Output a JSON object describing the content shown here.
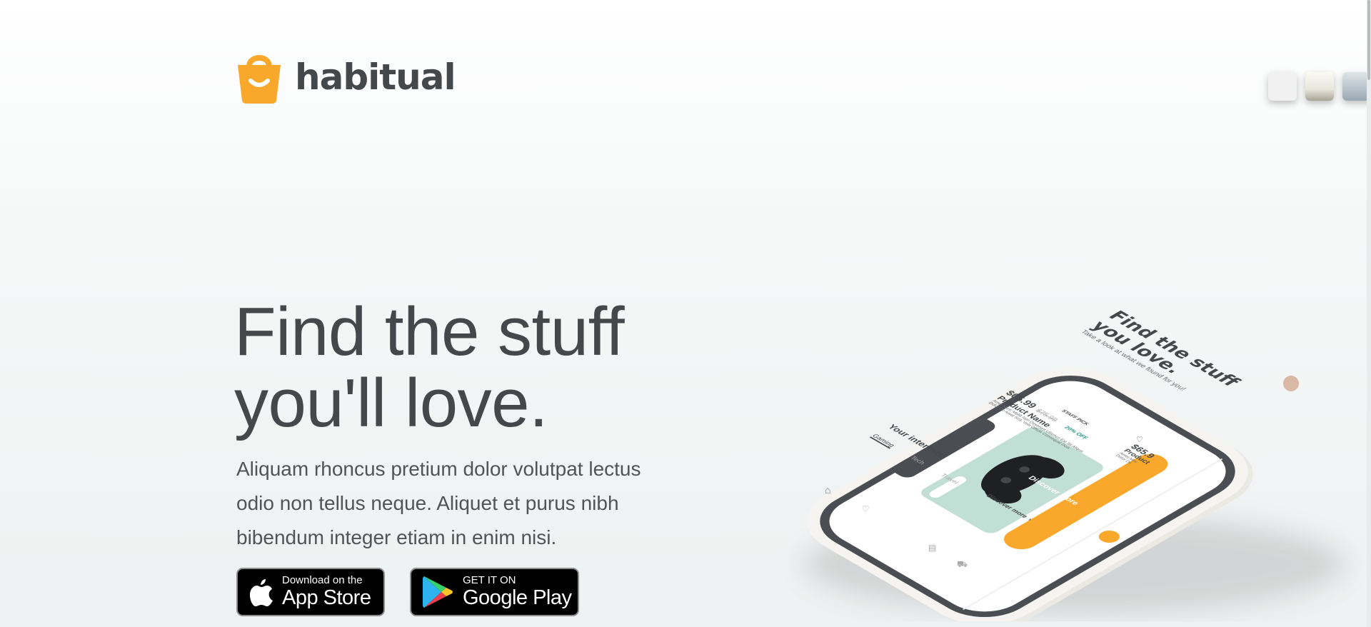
{
  "brand": {
    "name": "habitual",
    "accent": "#F9A82B",
    "text_color": "#45484B"
  },
  "hero": {
    "headline_line1": "Find the stuff",
    "headline_line2": "you'll love.",
    "body": "Aliquam rhoncus pretium dolor volutpat lectus odio non tellus neque. Aliquet et purus nibh bibendum integer etiam in enim nisi."
  },
  "store_buttons": {
    "appstore": {
      "small": "Download on the",
      "big": "App Store",
      "icon": "apple-icon"
    },
    "googleplay": {
      "small": "GET IT ON",
      "big": "Google Play",
      "icon": "google-play-icon"
    }
  },
  "phone_screen": {
    "title_line1": "Find the stuff",
    "title_line2": "you love.",
    "subtitle": "Take a look at what we found for you!",
    "card": {
      "badge": "STAFF PICK",
      "price": "$65.99",
      "old_price": "$75.99",
      "discount": "20% OFF",
      "product_name": "Product Name",
      "description_line1": "Amet Nunc Mollit Non Deserunt Ullamco Est Sit Aliqua",
      "description_line2": "Dolor Do Amet Sint. Velit Officia Consequat Duis.",
      "card_color": "#C2DFD5"
    },
    "second_card": {
      "price": "$65.9",
      "product_name": "Product",
      "description": "Amet Mini",
      "description_line2": "Dolor Do"
    },
    "cta": "Discover more",
    "interests": {
      "heading": "Your interests",
      "tabs": [
        "Gaming",
        "Tech",
        "Travel"
      ],
      "more": "Discover more"
    },
    "nav_icons": [
      "home-icon",
      "heart-icon",
      "search-icon",
      "receipt-icon",
      "cart-icon"
    ]
  }
}
